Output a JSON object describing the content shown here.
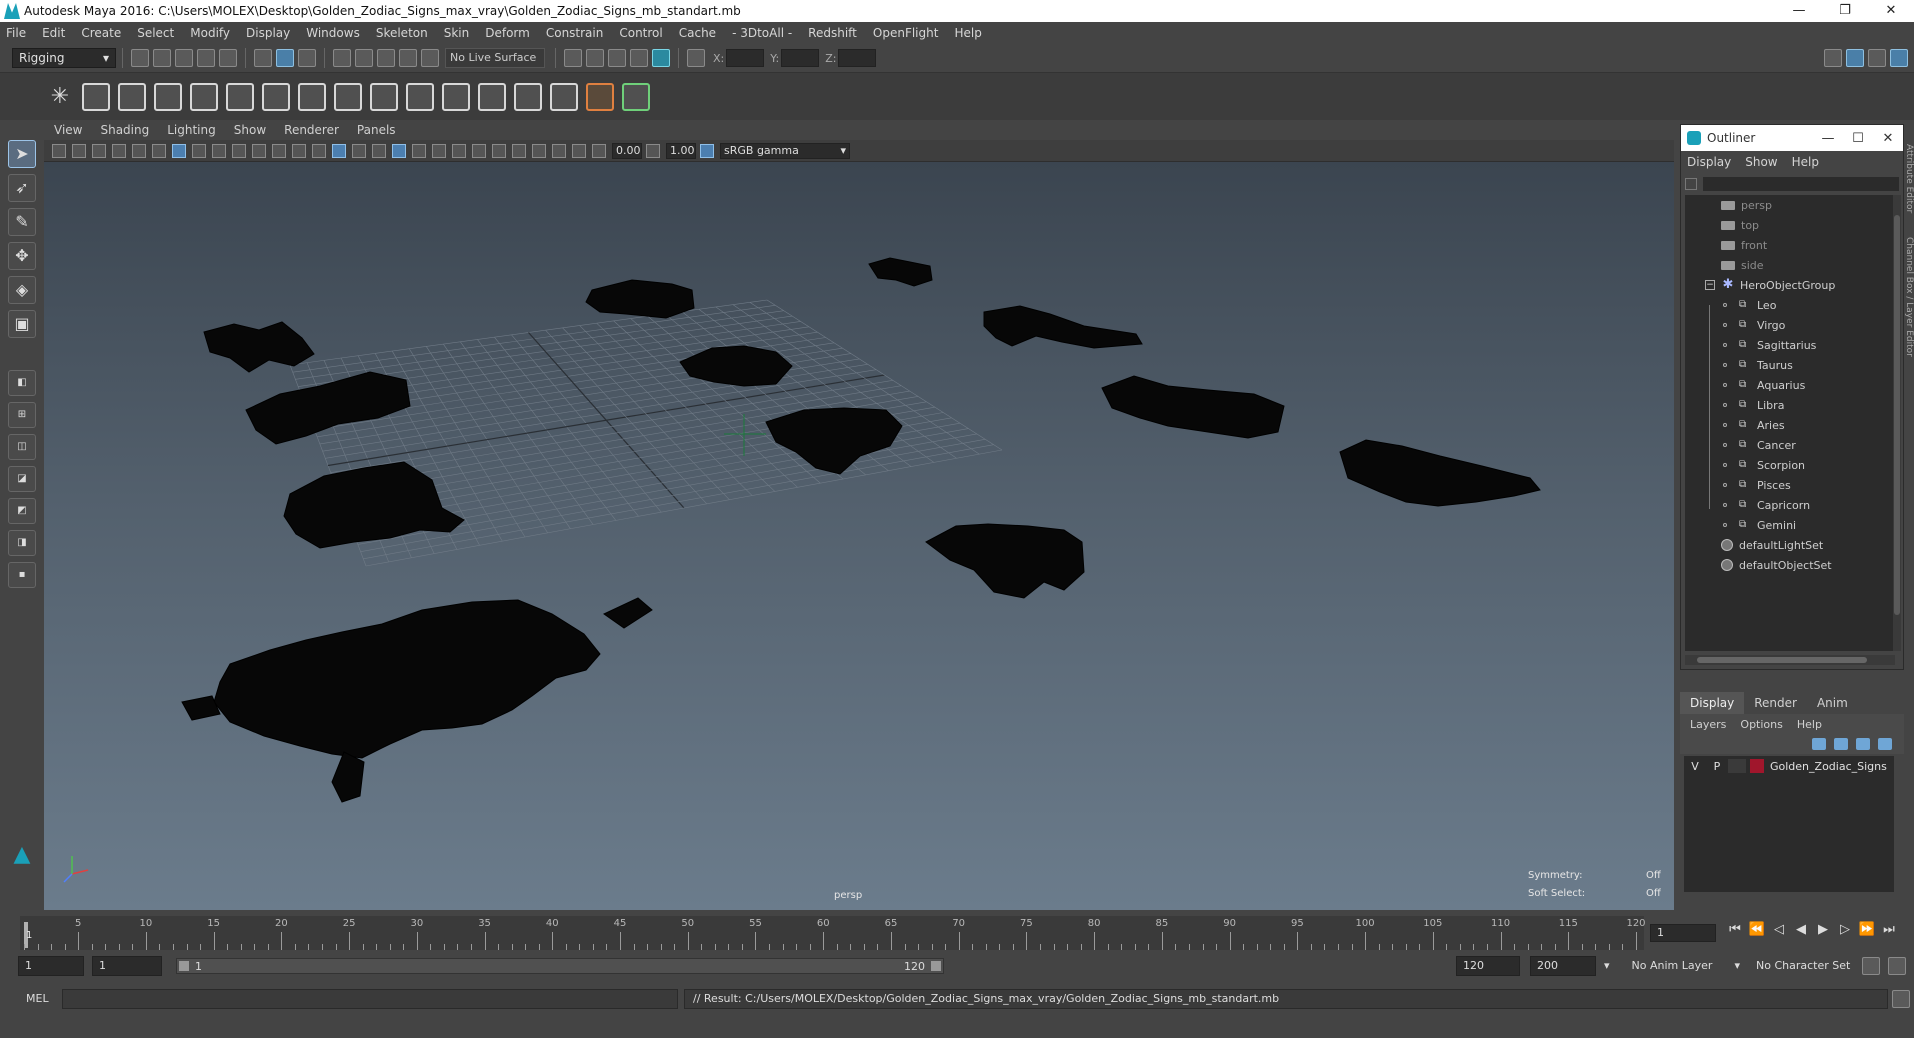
{
  "window": {
    "title": "Autodesk Maya 2016: C:\\Users\\MOLEX\\Desktop\\Golden_Zodiac_Signs_max_vray\\Golden_Zodiac_Signs_mb_standart.mb",
    "minimize": "—",
    "restore": "❐",
    "close": "✕"
  },
  "menubar": [
    "File",
    "Edit",
    "Create",
    "Select",
    "Modify",
    "Display",
    "Windows",
    "Skeleton",
    "Skin",
    "Deform",
    "Constrain",
    "Control",
    "Cache",
    "- 3DtoAll -",
    "Redshift",
    "OpenFlight",
    "Help"
  ],
  "statusline": {
    "mode": "Rigging",
    "live_surface": "No Live Surface",
    "x_label": "X:",
    "y_label": "Y:",
    "z_label": "Z:"
  },
  "panel": {
    "menus": [
      "View",
      "Shading",
      "Lighting",
      "Show",
      "Renderer",
      "Panels"
    ],
    "exposure": "0.00",
    "gamma": "1.00",
    "color_space": "sRGB gamma",
    "camera_label": "persp",
    "symmetry_label": "Symmetry:",
    "symmetry_value": "Off",
    "soft_select_label": "Soft Select:",
    "soft_select_value": "Off"
  },
  "outliner": {
    "title": "Outliner",
    "menus": [
      "Display",
      "Show",
      "Help"
    ],
    "cameras": [
      "persp",
      "top",
      "front",
      "side"
    ],
    "group": "HeroObjectGroup",
    "children": [
      "Leo",
      "Virgo",
      "Sagittarius",
      "Taurus",
      "Aquarius",
      "Libra",
      "Aries",
      "Cancer",
      "Scorpion",
      "Pisces",
      "Capricorn",
      "Gemini"
    ],
    "sets": [
      "defaultLightSet",
      "defaultObjectSet"
    ]
  },
  "layers": {
    "tabs": [
      "Display",
      "Render",
      "Anim"
    ],
    "menus": [
      "Layers",
      "Options",
      "Help"
    ],
    "items": [
      {
        "v": "V",
        "p": "P",
        "name": "Golden_Zodiac_Signs",
        "color": "#a0162c"
      }
    ]
  },
  "timeline": {
    "ticks": [
      5,
      10,
      15,
      20,
      25,
      30,
      35,
      40,
      45,
      50,
      55,
      60,
      65,
      70,
      75,
      80,
      85,
      90,
      95,
      100,
      105,
      110,
      115,
      120
    ],
    "current_marker": "1",
    "current_frame": "1",
    "range_start_outer": "1",
    "range_start": "1",
    "slider_start": "1",
    "slider_end": "120",
    "range_end": "120",
    "range_end_outer": "200",
    "anim_layer": "No Anim Layer",
    "character_set": "No Character Set"
  },
  "cmdline": {
    "lang": "MEL",
    "result": "// Result: C:/Users/MOLEX/Desktop/Golden_Zodiac_Signs_max_vray/Golden_Zodiac_Signs_mb_standart.mb"
  }
}
